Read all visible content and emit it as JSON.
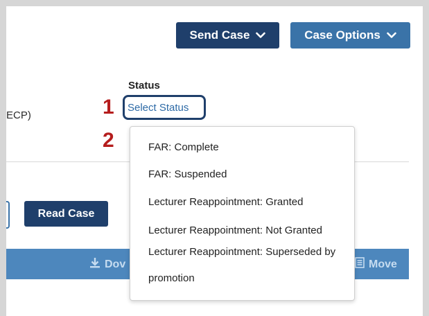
{
  "header": {
    "send_case_label": "Send Case",
    "case_options_label": "Case Options"
  },
  "case": {
    "truncated_text": "ECP)",
    "status_label": "Status",
    "status_select_value": "Select Status"
  },
  "annotations": {
    "step1": "1",
    "step2": "2"
  },
  "actions": {
    "read_case_label": "Read Case"
  },
  "toolbar": {
    "download_label": "Dov",
    "move_label": "Move"
  },
  "dropdown": {
    "options": [
      "FAR: Complete",
      "FAR: Suspended",
      "Lecturer Reappointment: Granted",
      "Lecturer Reappointment: Not Granted",
      "Lecturer Reappointment: Superseded by promotion"
    ]
  },
  "colors": {
    "primary_dark": "#1f3f6b",
    "primary": "#3a73a8",
    "toolbar": "#4d87bd",
    "annotation_red": "#b51d1d",
    "link_blue": "#2d6aa6"
  }
}
